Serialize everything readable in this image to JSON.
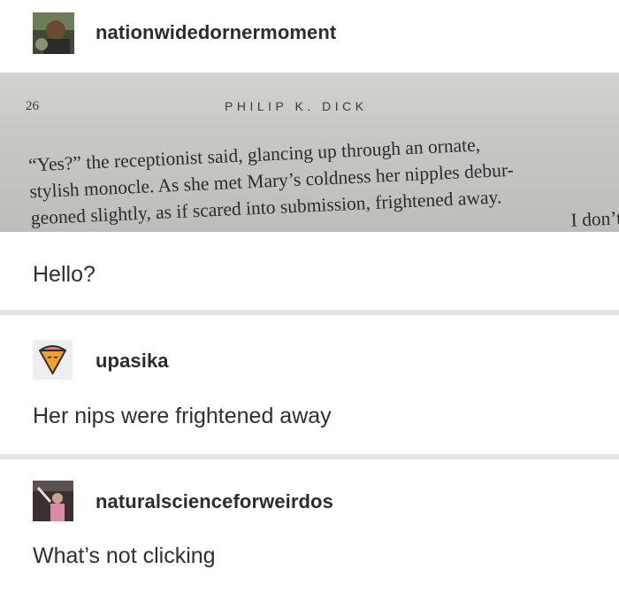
{
  "posts": [
    {
      "username": "nationwidedornermoment",
      "avatar": "person-avatar-icon",
      "book_page": {
        "page_number": "26",
        "running_head": "PHILIP K. DICK",
        "lines": [
          "“Yes?” the receptionist said, glancing up through an ornate,",
          "stylish monocle. As she met Mary’s coldness her nipples debur-",
          "geoned slightly, as if scared into submission, frightened away.",
          "I don’t"
        ]
      },
      "text": "Hello?"
    },
    {
      "username": "upasika",
      "avatar": "ice-cream-cone-avatar-icon",
      "text": "Her nips were frightened away"
    },
    {
      "username": "naturalscienceforweirdos",
      "avatar": "person-photo-avatar-icon",
      "text": "What’s not clicking"
    }
  ],
  "colors": {
    "background": "#ffffff",
    "separator": "#e3e3e3",
    "text": "#2f2f2f"
  }
}
